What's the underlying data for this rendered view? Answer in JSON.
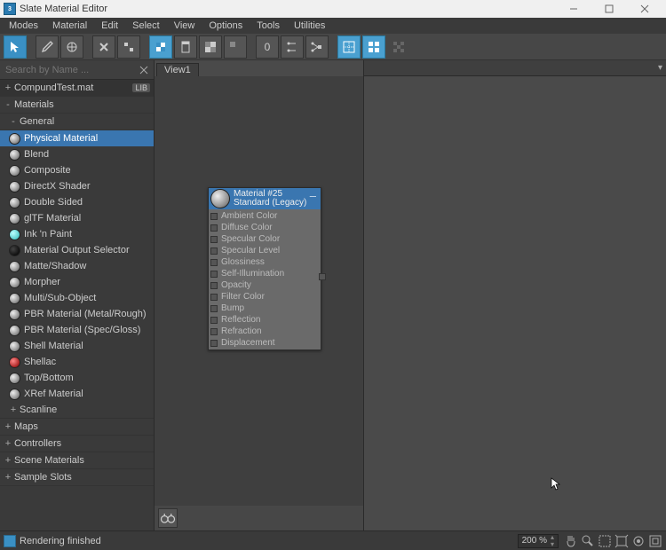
{
  "window": {
    "title": "Slate Material Editor",
    "app_icon_text": "3"
  },
  "menubar": [
    "Modes",
    "Material",
    "Edit",
    "Select",
    "View",
    "Options",
    "Tools",
    "Utilities"
  ],
  "toolbar": {
    "pick_value": "0"
  },
  "search": {
    "placeholder": "Search by Name ..."
  },
  "tree": {
    "compound_file": "CompundTest.mat",
    "lib_badge": "LIB",
    "materials_label": "Materials",
    "general_label": "General",
    "general_items": [
      "Physical Material",
      "Blend",
      "Composite",
      "DirectX Shader",
      "Double Sided",
      "glTF Material",
      "Ink 'n Paint",
      "Material Output Selector",
      "Matte/Shadow",
      "Morpher",
      "Multi/Sub-Object",
      "PBR Material (Metal/Rough)",
      "PBR Material (Spec/Gloss)",
      "Shell Material",
      "Shellac",
      "Top/Bottom",
      "XRef Material"
    ],
    "sections": [
      "Scanline",
      "Maps",
      "Controllers",
      "Scene Materials",
      "Sample Slots"
    ]
  },
  "view": {
    "tab_label": "View1"
  },
  "node": {
    "title": "Material #25",
    "subtitle": "Standard (Legacy)",
    "slots": [
      "Ambient Color",
      "Diffuse Color",
      "Specular Color",
      "Specular Level",
      "Glossiness",
      "Self-Illumination",
      "Opacity",
      "Filter Color",
      "Bump",
      "Reflection",
      "Refraction",
      "Displacement"
    ]
  },
  "status": {
    "text": "Rendering finished",
    "zoom": "200 %"
  }
}
